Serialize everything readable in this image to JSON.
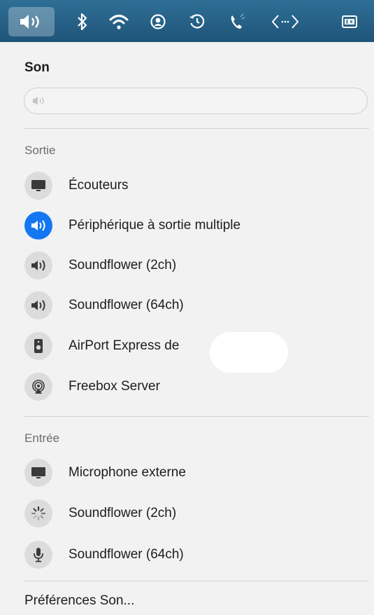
{
  "menubar": {
    "icons": [
      "speaker-icon",
      "bluetooth-icon",
      "wifi-icon",
      "user-icon",
      "time-machine-icon",
      "phone-icon",
      "code-icon",
      "keyboard-input-icon"
    ]
  },
  "panel": {
    "title": "Son",
    "output_section": "Sortie",
    "outputs": [
      {
        "label": "Écouteurs",
        "icon": "display-icon",
        "selected": false
      },
      {
        "label": "Périphérique à sortie multiple",
        "icon": "speaker-icon",
        "selected": true
      },
      {
        "label": "Soundflower (2ch)",
        "icon": "speaker-icon",
        "selected": false
      },
      {
        "label": "Soundflower (64ch)",
        "icon": "speaker-icon",
        "selected": false
      },
      {
        "label": "AirPort Express de",
        "icon": "airport-express-icon",
        "selected": false
      },
      {
        "label": "Freebox Server",
        "icon": "airplay-icon",
        "selected": false
      }
    ],
    "input_section": "Entrée",
    "inputs": [
      {
        "label": "Microphone externe",
        "icon": "display-icon"
      },
      {
        "label": "Soundflower (2ch)",
        "icon": "spinner-icon"
      },
      {
        "label": "Soundflower (64ch)",
        "icon": "microphone-icon"
      }
    ],
    "preferences_label": "Préférences Son..."
  },
  "colors": {
    "menubar": "#2a6489",
    "selected": "#1477f1",
    "icon_bg": "#dcdcdc"
  }
}
